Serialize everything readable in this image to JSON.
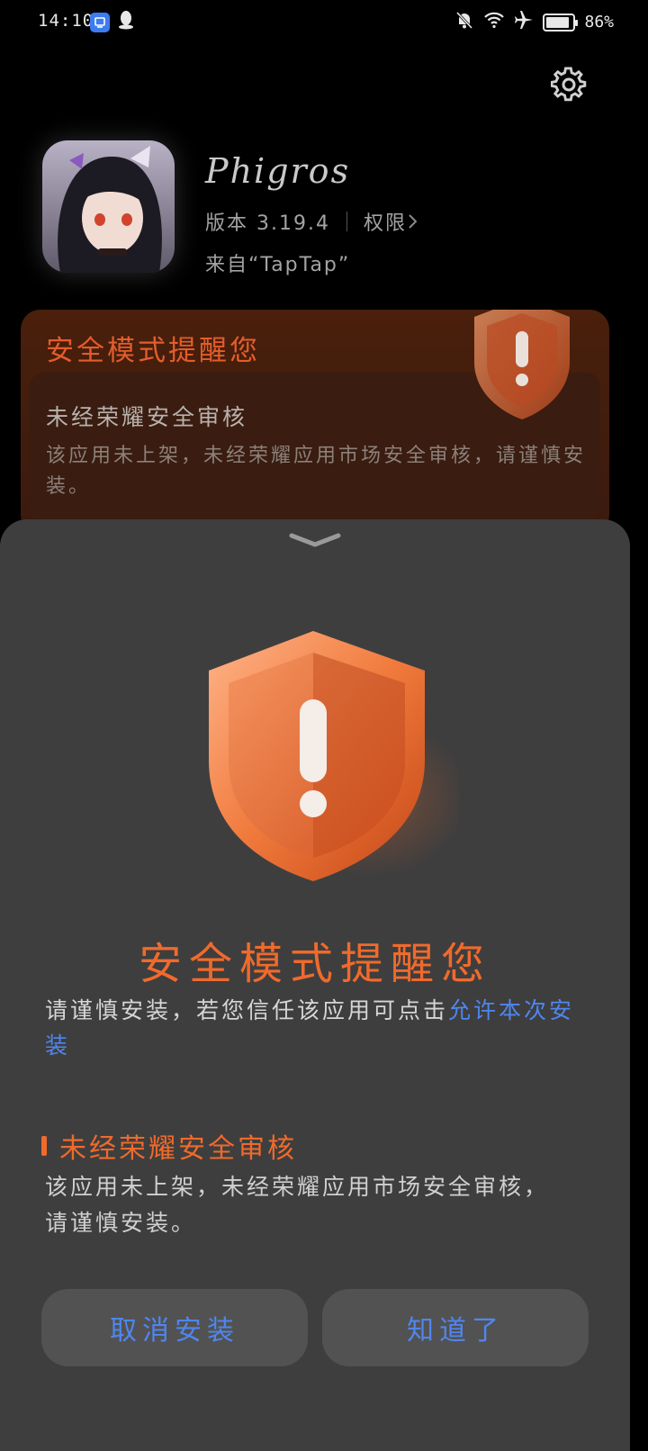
{
  "status_bar": {
    "time": "14:10",
    "battery_percent": "86%",
    "battery_level": 0.86,
    "icons": [
      "app-notification-icon",
      "qq-icon",
      "mute-bell-icon",
      "wifi-icon",
      "airplane-icon",
      "battery-icon"
    ]
  },
  "app": {
    "name": "Phigros",
    "version": "版本 3.19.4",
    "permissions_label": "权限",
    "source": "来自“TapTap”"
  },
  "background_card": {
    "title": "安全模式提醒您",
    "subtitle": "未经荣耀安全审核",
    "text": "该应用未上架，未经荣耀应用市场安全审核，请谨慎安装。"
  },
  "sheet": {
    "title": "安全模式提醒您",
    "description_prefix": "请谨慎安装，若您信任该应用可点击",
    "allow_link": "允许本次安装",
    "reason_title": "未经荣耀安全审核",
    "reason_text": "该应用未上架，未经荣耀应用市场安全审核，请谨慎安装。",
    "cancel_button": "取消安装",
    "ok_button": "知道了"
  },
  "colors": {
    "accent_orange": "#f06a2c",
    "link_blue": "#4f86f0",
    "sheet_bg": "#3e3e3e"
  }
}
